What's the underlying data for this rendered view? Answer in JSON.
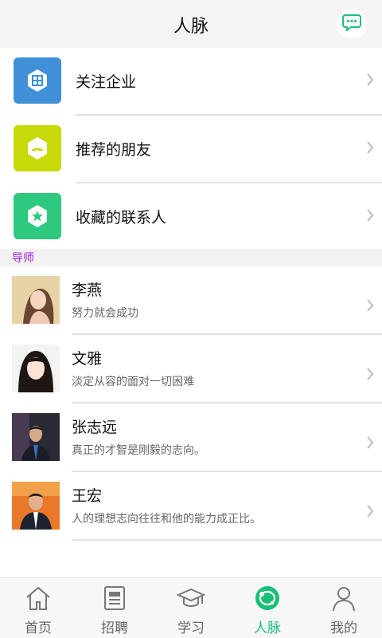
{
  "header": {
    "title": "人脉",
    "message_icon": "chat-bubble-icon"
  },
  "menu": [
    {
      "label": "关注企业",
      "icon": "building-icon",
      "color": "#3f90d6"
    },
    {
      "label": "推荐的朋友",
      "icon": "mustache-icon",
      "color": "#c8d90a"
    },
    {
      "label": "收藏的联系人",
      "icon": "star-icon",
      "color": "#2ec97f"
    }
  ],
  "section": {
    "title": "导师"
  },
  "mentors": [
    {
      "name": "李燕",
      "motto": "努力就会成功"
    },
    {
      "name": "文雅",
      "motto": "淡定从容的面对一切困难"
    },
    {
      "name": "张志远",
      "motto": "真正的才智是刚毅的志向。"
    },
    {
      "name": "王宏",
      "motto": "人的理想志向往往和他的能力成正比。"
    }
  ],
  "tabs": [
    {
      "label": "首页",
      "icon": "home-icon",
      "active": false
    },
    {
      "label": "招聘",
      "icon": "newspaper-icon",
      "active": false
    },
    {
      "label": "学习",
      "icon": "graduation-cap-icon",
      "active": false
    },
    {
      "label": "人脉",
      "icon": "network-icon",
      "active": true
    },
    {
      "label": "我的",
      "icon": "user-icon",
      "active": false
    }
  ],
  "colors": {
    "accent": "#1bbf76",
    "section_title": "#9b1fd6"
  }
}
